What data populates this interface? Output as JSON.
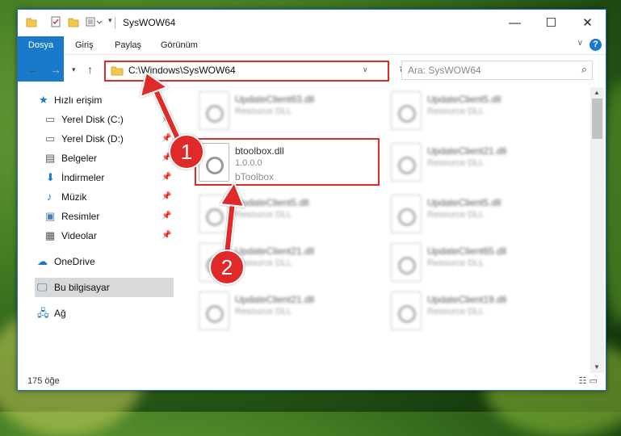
{
  "window": {
    "title": "SysWOW64",
    "controls": {
      "minimize": "—",
      "maximize": "☐",
      "close": "✕"
    }
  },
  "ribbon": {
    "tabs": [
      "Dosya",
      "Giriş",
      "Paylaş",
      "Görünüm"
    ],
    "help": "?"
  },
  "address": {
    "path": "C:\\Windows\\SysWOW64"
  },
  "search": {
    "placeholder": "Ara: SysWOW64"
  },
  "nav": {
    "quick_access": "Hızlı erişim",
    "items": [
      {
        "label": "Yerel Disk (C:)",
        "icon": "drive-icon"
      },
      {
        "label": "Yerel Disk (D:)",
        "icon": "drive-icon"
      },
      {
        "label": "Belgeler",
        "icon": "documents-icon"
      },
      {
        "label": "İndirmeler",
        "icon": "download-icon"
      },
      {
        "label": "Müzik",
        "icon": "music-icon"
      },
      {
        "label": "Resimler",
        "icon": "pictures-icon"
      },
      {
        "label": "Videolar",
        "icon": "videos-icon"
      }
    ],
    "onedrive": "OneDrive",
    "this_pc": "Bu bilgisayar",
    "network": "Ağ"
  },
  "files": {
    "selected": {
      "name": "btoolbox.dll",
      "version": "1.0.0.0",
      "description": "bToolbox"
    },
    "left_column": [
      {
        "name": "UpdateClient63.dll",
        "type": "Resource DLL"
      },
      {
        "name": "UpdateClient5.dll",
        "type": "Resource DLL"
      },
      {
        "name": "UpdateClient21.dll",
        "type": "Resource DLL"
      },
      {
        "name": "UpdateClient21.dll",
        "type": "Resource DLL"
      }
    ],
    "right_column": [
      {
        "name": "UpdateClient5.dll",
        "type": "Resource DLL"
      },
      {
        "name": "UpdateClient21.dll",
        "type": "Resource DLL"
      },
      {
        "name": "UpdateClient5.dll",
        "type": "Resource DLL"
      },
      {
        "name": "UpdateClient65.dll",
        "type": "Resource DLL"
      },
      {
        "name": "UpdateClient19.dll",
        "type": "Resource DLL"
      }
    ]
  },
  "status": {
    "count": "175 öğe"
  },
  "annotations": {
    "step1": "1",
    "step2": "2"
  },
  "colors": {
    "accent": "#1979ca",
    "annotation": "#e02a2a"
  }
}
